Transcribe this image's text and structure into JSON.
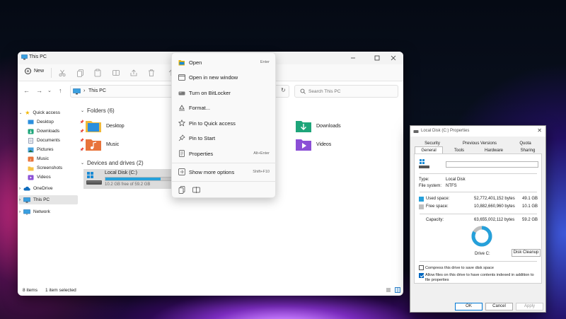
{
  "explorer": {
    "title": "This PC",
    "toolbar": {
      "new_label": "New"
    },
    "address": {
      "path": "This PC"
    },
    "search": {
      "placeholder": "Search This PC"
    },
    "nav": {
      "quick_access": "Quick access",
      "items": [
        "Desktop",
        "Downloads",
        "Documents",
        "Pictures",
        "Music",
        "Screenshots",
        "Videos"
      ],
      "onedrive": "OneDrive",
      "this_pc": "This PC",
      "network": "Network"
    },
    "folders_header": "Folders (6)",
    "folders": [
      "Desktop",
      "Downloads",
      "Music",
      "Videos"
    ],
    "drives_header": "Devices and drives (2)",
    "drive": {
      "label": "Local Disk (C:)",
      "free_text": "10.2 GB free of 59.2 GB",
      "used_fraction": 0.83
    },
    "status": {
      "items": "8 items",
      "selected": "1 item selected"
    }
  },
  "context_menu": {
    "items": [
      {
        "label": "Open",
        "shortcut": "Enter",
        "icon": "open-icon"
      },
      {
        "label": "Open in new window",
        "shortcut": "",
        "icon": "new-window-icon"
      },
      {
        "label": "Turn on BitLocker",
        "shortcut": "",
        "icon": "bitlocker-icon"
      },
      {
        "label": "Format...",
        "shortcut": "",
        "icon": "format-icon"
      },
      {
        "label": "Pin to Quick access",
        "shortcut": "",
        "icon": "star-icon"
      },
      {
        "label": "Pin to Start",
        "shortcut": "",
        "icon": "pin-icon"
      },
      {
        "label": "Properties",
        "shortcut": "Alt+Enter",
        "icon": "properties-icon"
      },
      {
        "label": "Show more options",
        "shortcut": "Shift+F10",
        "icon": "more-options-icon"
      }
    ]
  },
  "properties": {
    "title": "Local Disk (C:) Properties",
    "tabs_row1": [
      "Security",
      "Previous Versions",
      "Quota"
    ],
    "tabs_row2": [
      "General",
      "Tools",
      "Hardware",
      "Sharing"
    ],
    "type_label": "Type:",
    "type_value": "Local Disk",
    "fs_label": "File system:",
    "fs_value": "NTFS",
    "used_label": "Used space:",
    "used_bytes": "52,772,401,152 bytes",
    "used_gb": "49.1 GB",
    "free_label": "Free space:",
    "free_bytes": "10,882,660,960 bytes",
    "free_gb": "10.1 GB",
    "capacity_label": "Capacity:",
    "capacity_bytes": "63,655,002,112 bytes",
    "capacity_gb": "59.2 GB",
    "drive_caption": "Drive C:",
    "cleanup_label": "Disk Cleanup",
    "compress_label": "Compress this drive to save disk space",
    "index_label": "Allow files on this drive to have contents indexed in addition to file properties",
    "ok_label": "OK",
    "cancel_label": "Cancel",
    "apply_label": "Apply",
    "used_color": "#26a0da",
    "free_color": "#bfbfbf",
    "used_fraction": 0.829
  }
}
